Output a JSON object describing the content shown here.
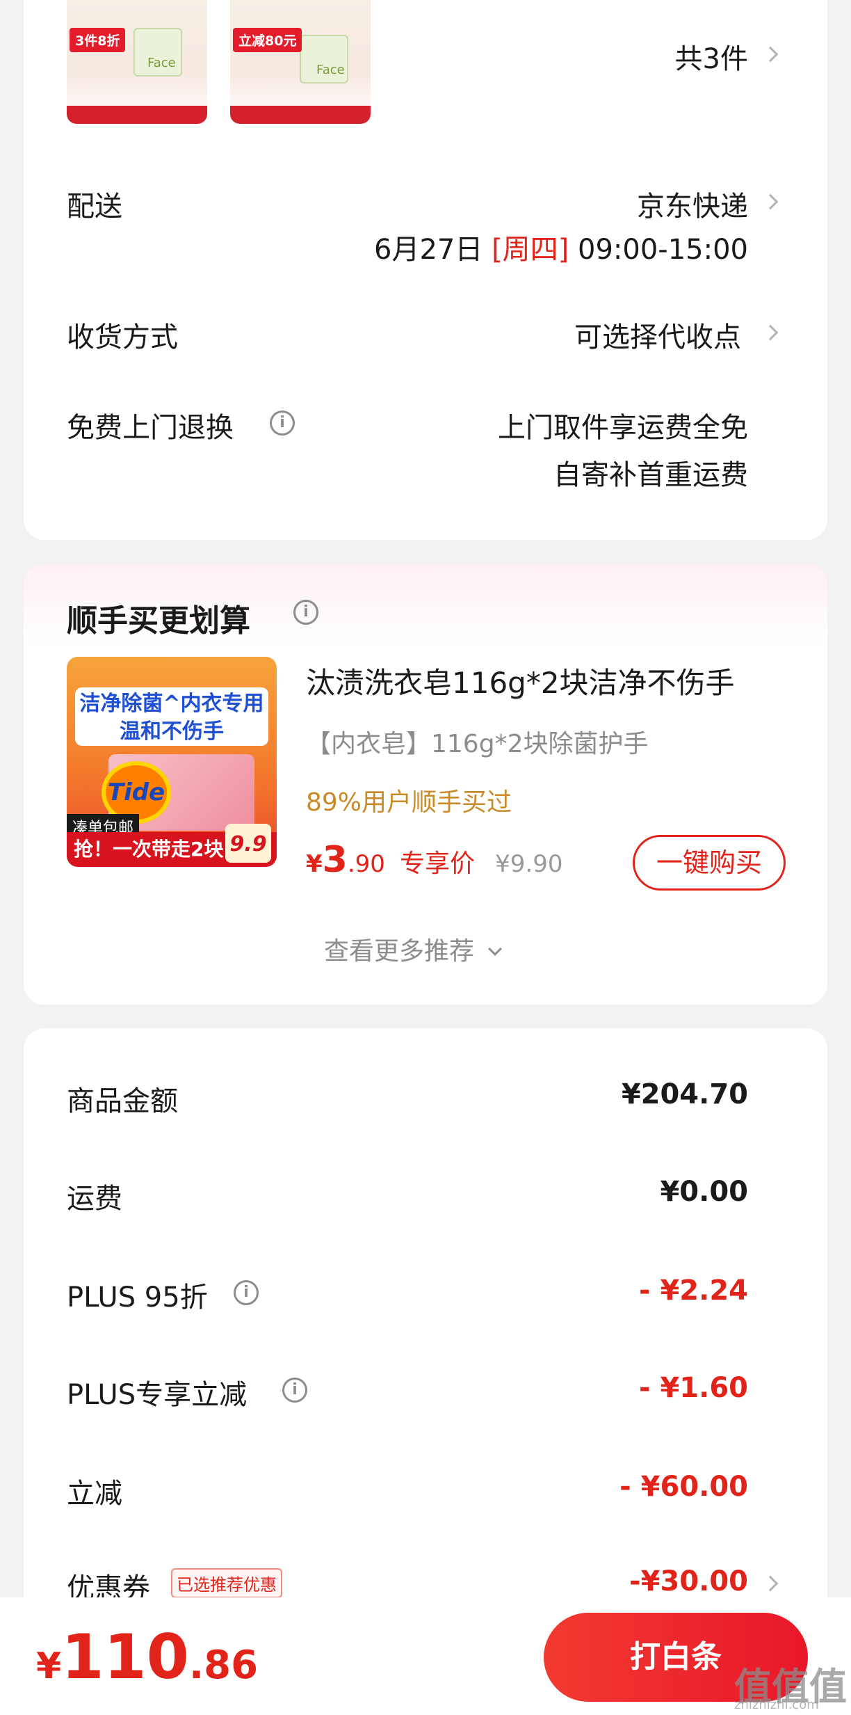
{
  "order": {
    "count_label": "共3件",
    "thumbs": [
      {
        "tag": "3件8折",
        "brand": "Face"
      },
      {
        "tag": "立减80元",
        "brand": "Face"
      }
    ]
  },
  "delivery": {
    "label": "配送",
    "carrier": "京东快递",
    "date": "6月27日",
    "weekday": "[周四]",
    "time": "09:00-15:00"
  },
  "receive": {
    "label": "收货方式",
    "value": "可选择代收点"
  },
  "returns": {
    "label": "免费上门退换",
    "line1": "上门取件享运费全免",
    "line2": "自寄补首重运费"
  },
  "addon": {
    "title": "顺手买更划算",
    "product_title": "汰渍洗衣皂116g*2块洁净不伤手",
    "subtitle": "【内衣皂】116g*2块除菌护手",
    "social": "89%用户顺手买过",
    "price_symbol": "¥",
    "price_int": "3",
    "price_dec": ".90",
    "price_tag": "专享价",
    "orig_price": "¥9.90",
    "buy_label": "一键购买",
    "more_label": "查看更多推荐",
    "image": {
      "banner1": "洁净除菌^内衣专用",
      "banner2": "温和不伤手",
      "logo": "Tide",
      "mini": "凑单包邮",
      "ribbon": "抢！一次带走2块",
      "badge": "9.9"
    }
  },
  "summary": {
    "rows": [
      {
        "label": "商品金额",
        "value": "¥204.70"
      },
      {
        "label": "运费",
        "value": "¥0.00"
      },
      {
        "label": "PLUS 95折",
        "value": "- ¥2.24"
      },
      {
        "label": "PLUS专享立减",
        "value": "- ¥1.60"
      },
      {
        "label": "立减",
        "value": "- ¥60.00"
      },
      {
        "label": "优惠券",
        "value": "-¥30.00"
      }
    ],
    "coupon_badge": "已选推荐优惠"
  },
  "footer": {
    "total_symbol": "¥",
    "total_int": "110",
    "total_dec": ".86",
    "pay_label": "打白条"
  },
  "watermark": {
    "text": "值值值",
    "sub": "zhizhizhi.com"
  },
  "colors": {
    "accent": "#e2231a",
    "social": "#c98a28",
    "bg": "#f2f2f2"
  }
}
